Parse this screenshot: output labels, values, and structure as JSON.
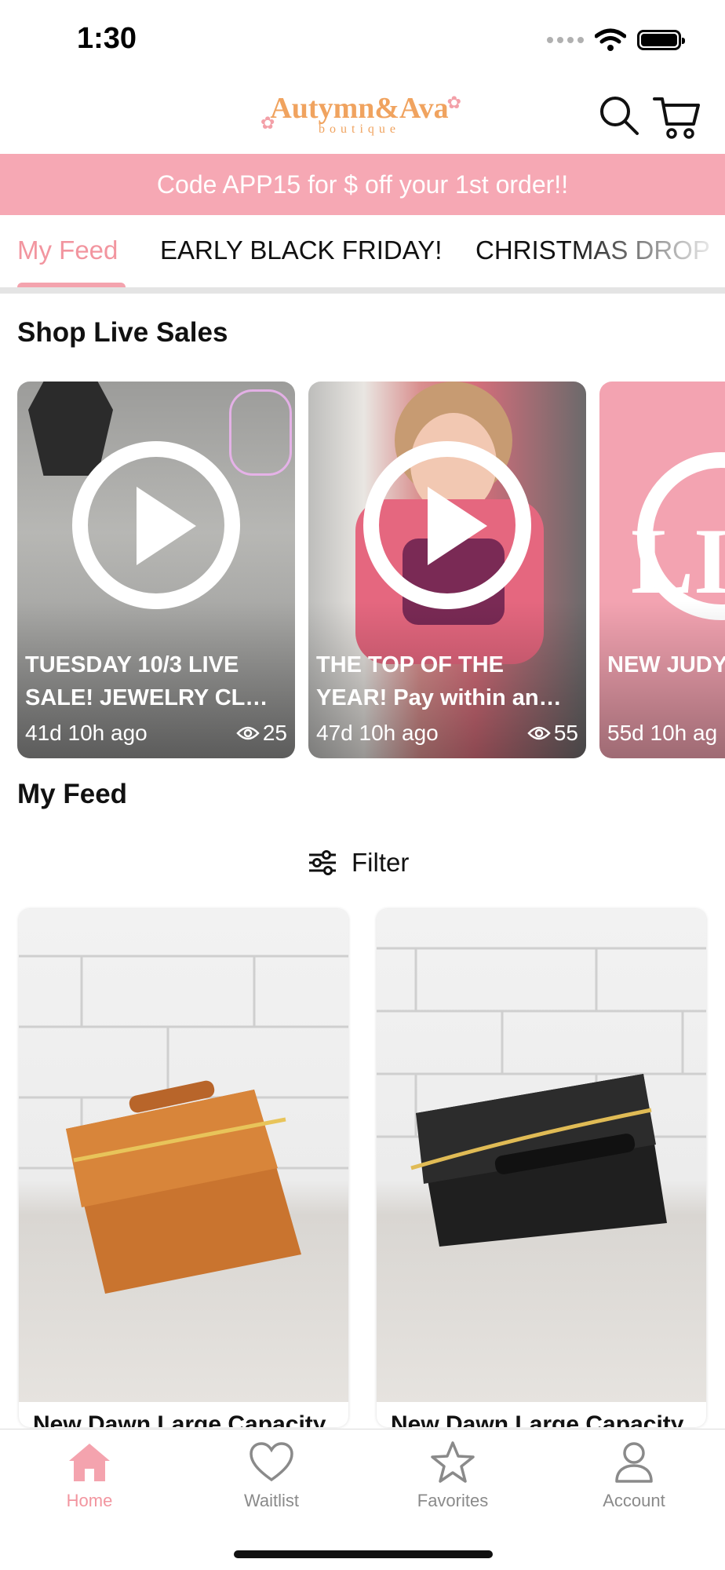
{
  "status_bar": {
    "time": "1:30"
  },
  "header": {
    "logo_main": "Autymn&Ava",
    "logo_sub": "boutique",
    "search_icon": "search-icon",
    "cart_icon": "cart-icon"
  },
  "promo": {
    "text": "Code APP15 for $ off your 1st order!!"
  },
  "tabs": [
    {
      "label": "My Feed",
      "active": true
    },
    {
      "label": "EARLY BLACK FRIDAY!",
      "active": false
    },
    {
      "label": "CHRISTMAS DROP",
      "active": false
    }
  ],
  "live_section": {
    "title": "Shop Live Sales",
    "cards": [
      {
        "title": "TUESDAY 10/3 LIVE SALE! JEWELRY CL…",
        "time": "41d 10h ago",
        "views": "25"
      },
      {
        "title": "THE TOP OF THE YEAR! Pay within an…",
        "time": "47d 10h ago",
        "views": "55"
      },
      {
        "title": "NEW JUDY NEW ANN",
        "time": "55d 10h ag",
        "views": ""
      }
    ]
  },
  "feed": {
    "title": "My Feed",
    "filter_label": "Filter",
    "products": [
      {
        "title": "New Dawn Large Capacity",
        "color": "#c9742f"
      },
      {
        "title": "New Dawn Large Capacity",
        "color": "#1f1f1f"
      }
    ]
  },
  "bottom_nav": [
    {
      "label": "Home",
      "icon": "home-icon",
      "active": true
    },
    {
      "label": "Waitlist",
      "icon": "heart-icon",
      "active": false
    },
    {
      "label": "Favorites",
      "icon": "star-icon",
      "active": false
    },
    {
      "label": "Account",
      "icon": "person-icon",
      "active": false
    }
  ],
  "colors": {
    "accent": "#f6a8b4",
    "accent_text": "#f2959f"
  }
}
